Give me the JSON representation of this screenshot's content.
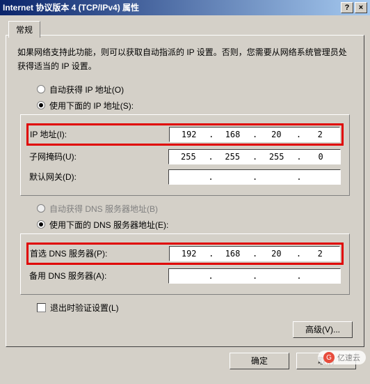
{
  "title": "Internet 协议版本 4 (TCP/IPv4) 属性",
  "tab": {
    "general": "常规"
  },
  "desc": "如果网络支持此功能，则可以获取自动指派的 IP 设置。否则，您需要从网络系统管理员处获得适当的 IP 设置。",
  "ip_section": {
    "auto_label": "自动获得 IP 地址(O)",
    "manual_label": "使用下面的 IP 地址(S):",
    "ip_label": "IP 地址(I):",
    "ip": {
      "a": "192",
      "b": "168",
      "c": "20",
      "d": "2"
    },
    "mask_label": "子网掩码(U):",
    "mask": {
      "a": "255",
      "b": "255",
      "c": "255",
      "d": "0"
    },
    "gw_label": "默认网关(D):",
    "gw": {
      "a": "",
      "b": "",
      "c": "",
      "d": ""
    }
  },
  "dns_section": {
    "auto_label": "自动获得 DNS 服务器地址(B)",
    "manual_label": "使用下面的 DNS 服务器地址(E):",
    "pref_label": "首选 DNS 服务器(P):",
    "pref": {
      "a": "192",
      "b": "168",
      "c": "20",
      "d": "2"
    },
    "alt_label": "备用 DNS 服务器(A):",
    "alt": {
      "a": "",
      "b": "",
      "c": "",
      "d": ""
    }
  },
  "validate_label": "退出时验证设置(L)",
  "buttons": {
    "advanced": "高级(V)...",
    "ok": "确定",
    "cancel": "取消"
  },
  "watermark": "亿速云"
}
